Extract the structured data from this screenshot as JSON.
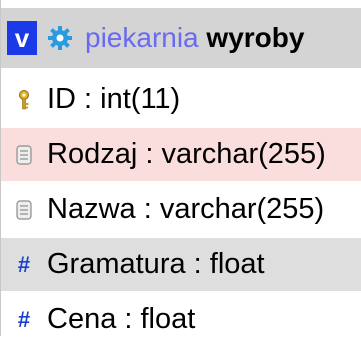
{
  "header": {
    "collapse_label": "v",
    "database": "piekarnia",
    "table": "wyroby"
  },
  "columns": [
    {
      "text": "ID : int(11)",
      "icon": "primary-key-icon",
      "highlight": "none"
    },
    {
      "text": "Rodzaj : varchar(255)",
      "icon": "text-field-icon",
      "highlight": "#fadddd"
    },
    {
      "text": "Nazwa : varchar(255)",
      "icon": "text-field-icon",
      "highlight": "none"
    },
    {
      "text": "Gramatura : float",
      "icon": "numeric-field-icon",
      "hash": "#",
      "highlight": "#dedede"
    },
    {
      "text": "Cena : float",
      "icon": "numeric-field-icon",
      "hash": "#",
      "highlight": "none"
    }
  ],
  "colors": {
    "collapse_button": "#1c39e8",
    "database_name": "#6a6af0",
    "header_bg": "#d4d4d4",
    "gear_icon": "#2a9be0"
  }
}
